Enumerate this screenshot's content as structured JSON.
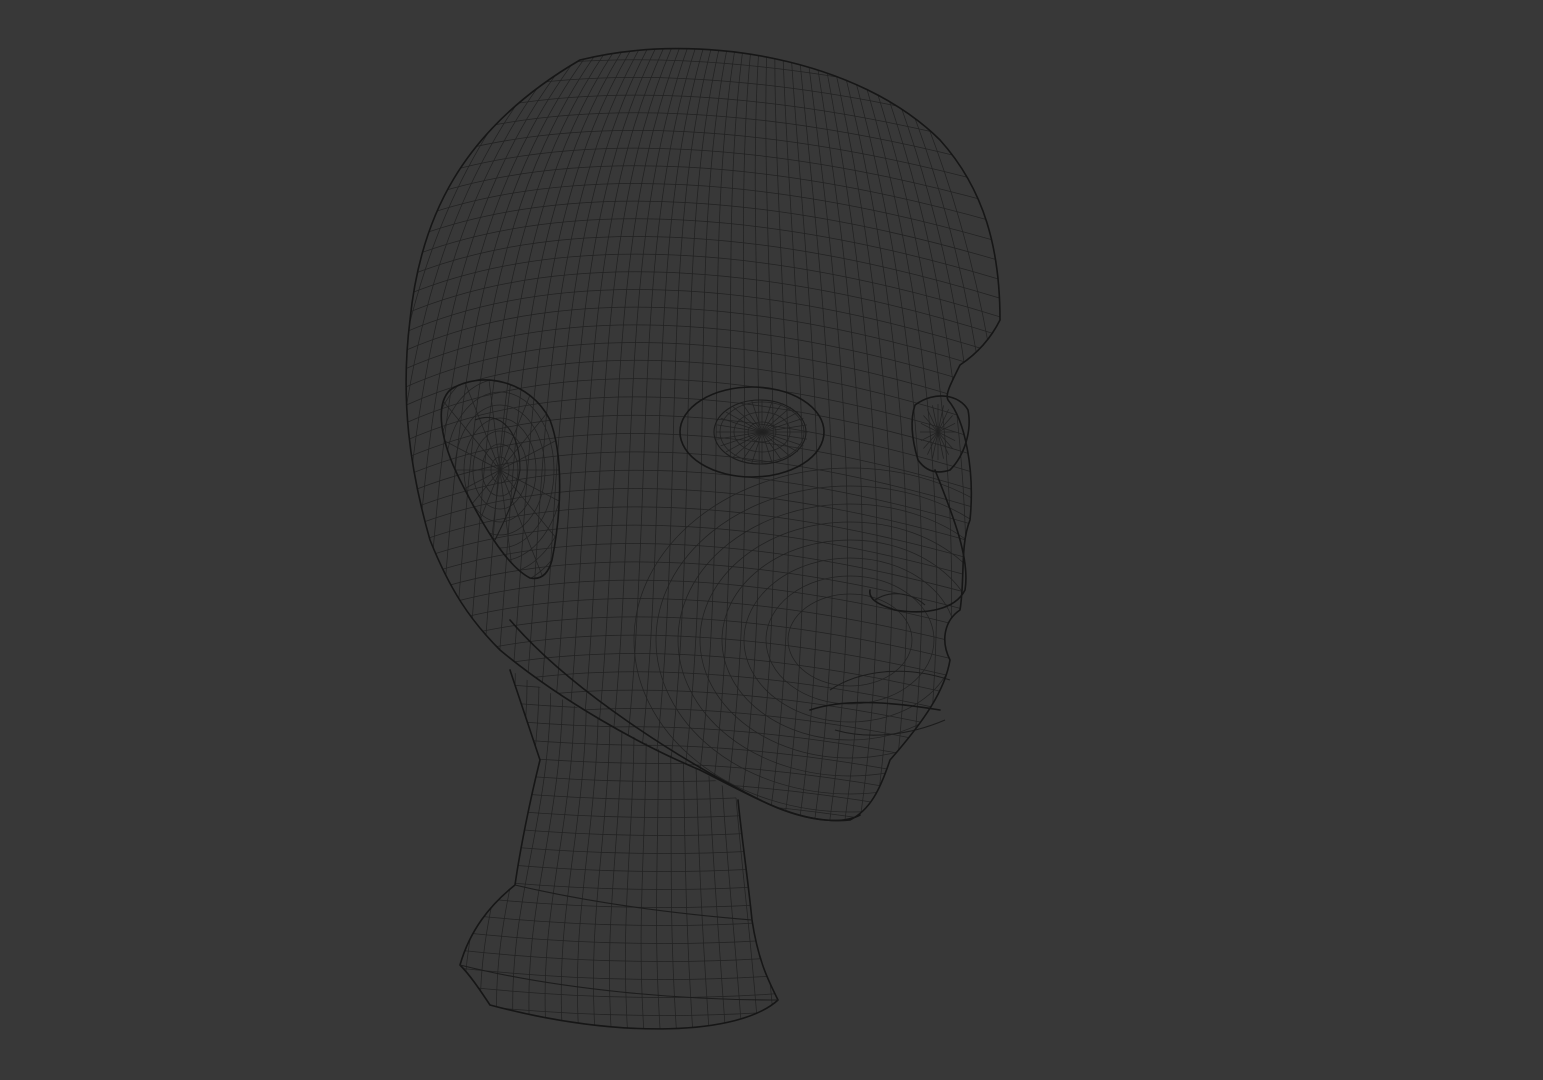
{
  "viewport": {
    "background": "#383838",
    "wire_color": "#222222",
    "edge_color": "#161616",
    "shading": "wireframe"
  },
  "model": {
    "parts": [
      "head",
      "ear",
      "left-eye",
      "right-eye",
      "nose",
      "mouth",
      "chin",
      "neck",
      "neck-base"
    ]
  }
}
